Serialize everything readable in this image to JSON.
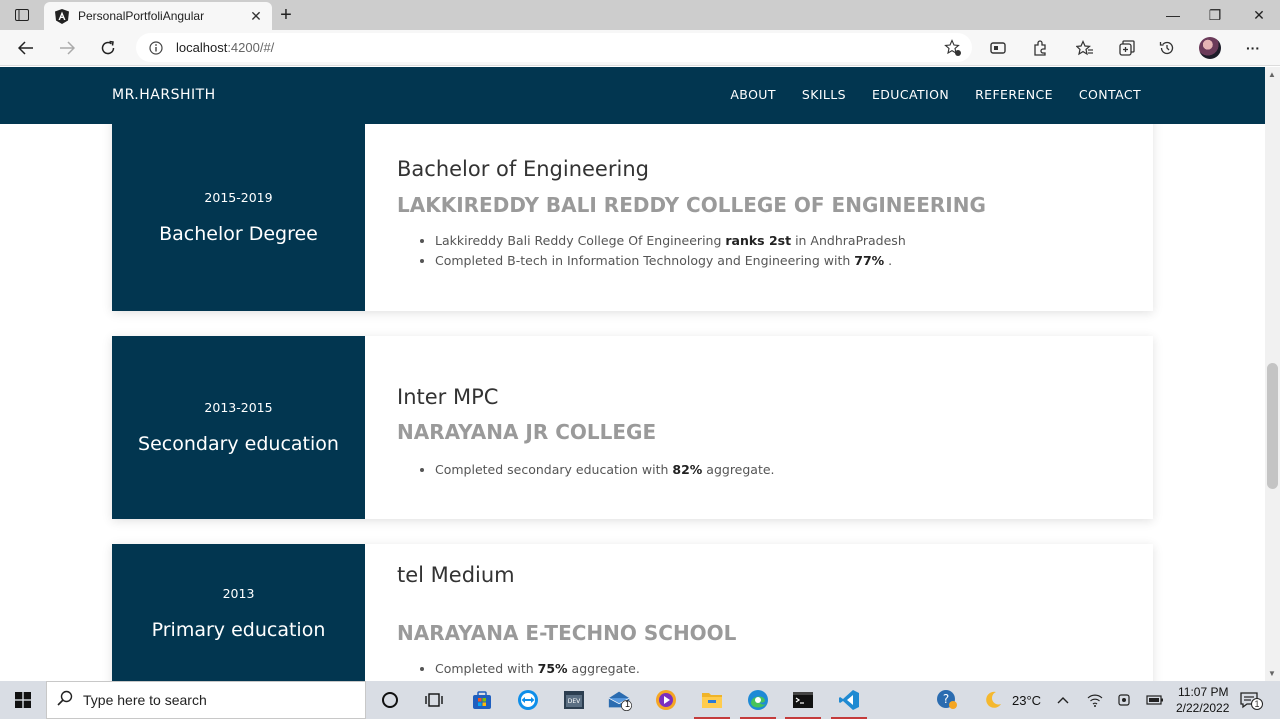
{
  "browser": {
    "tab_title": "PersonalPortfoliAngular",
    "url_host": "localhost",
    "url_rest": ":4200/#/",
    "close_glyph": "✕",
    "newtab_glyph": "+",
    "min_glyph": "—",
    "max_glyph": "❐",
    "winclose_glyph": "✕",
    "more_glyph": "···"
  },
  "site": {
    "brand": "MR.HARSHITH",
    "nav": [
      "ABOUT",
      "SKILLS",
      "EDUCATION",
      "REFERENCE",
      "CONTACT"
    ]
  },
  "education": [
    {
      "years": "2015-2019",
      "level": "Bachelor Degree",
      "degree": "Bachelor of Engineering",
      "school": "LAKKIREDDY BALI REDDY COLLEGE OF ENGINEERING",
      "points": [
        {
          "before": "Lakkireddy Bali Reddy College Of Engineering ",
          "bold": "ranks 2st",
          "after": " in AndhraPradesh"
        },
        {
          "before": "Completed B-tech in Information Technology and Engineering with ",
          "bold": "77%",
          "after": " ."
        }
      ]
    },
    {
      "years": "2013-2015",
      "level": "Secondary education",
      "degree": "Inter MPC",
      "school": "NARAYANA JR COLLEGE",
      "points": [
        {
          "before": "Completed secondary education with ",
          "bold": "82%",
          "after": " aggregate."
        }
      ]
    },
    {
      "years": "2013",
      "level": "Primary education",
      "degree": "tel Medium",
      "school": "NARAYANA E-TECHNO SCHOOL",
      "points": [
        {
          "before": "Completed with ",
          "bold": "75%",
          "after": " aggregate."
        }
      ]
    }
  ],
  "taskbar": {
    "search_placeholder": "Type here to search",
    "temperature": "23°C",
    "time": "11:07 PM",
    "date": "2/22/2022",
    "mail_badge": "1",
    "notif_badge": "1"
  },
  "colors": {
    "nav_bg": "#023650",
    "school_text": "#9a9a9a",
    "taskbar_bg": "#d9dde4"
  }
}
